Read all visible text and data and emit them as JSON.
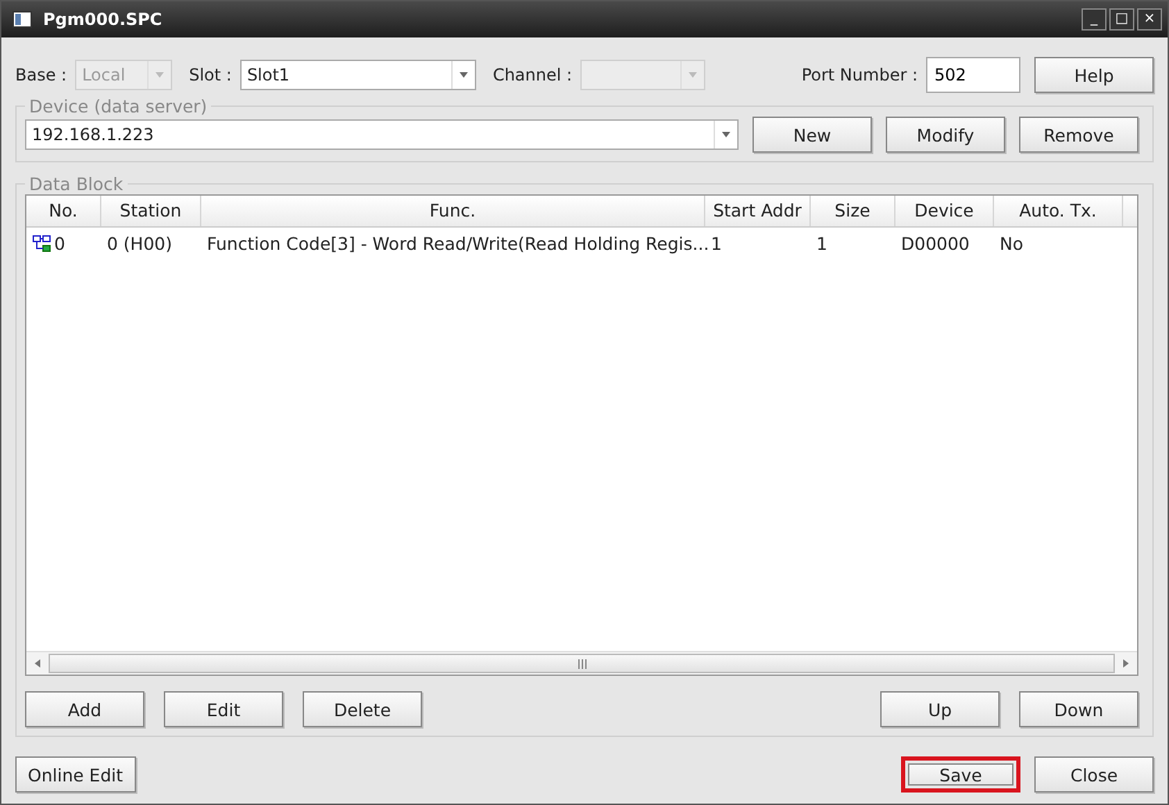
{
  "window": {
    "title": "Pgm000.SPC",
    "controls": [
      "_",
      "□",
      "×"
    ]
  },
  "base": {
    "label": "Base :",
    "value": "Local",
    "disabled": true
  },
  "slot": {
    "label": "Slot :",
    "value": "Slot1",
    "disabled": false
  },
  "channel": {
    "label": "Channel :",
    "disabled": true
  },
  "port": {
    "label": "Port Number :",
    "value": "502"
  },
  "help_button": "Help",
  "device_group": {
    "title": "Device (data server)",
    "value": "192.168.1.223",
    "buttons": [
      "New",
      "Modify",
      "Remove"
    ]
  },
  "data_block": {
    "title": "Data Block",
    "table": {
      "columns": [
        "No.",
        "Station",
        "Func.",
        "Start Addr",
        "Size",
        "Device",
        "Auto. Tx."
      ],
      "rows": [
        [
          "0",
          "0 (H00)",
          "Function Code[3] - Word Read/Write(Read Holding Regis...",
          "1",
          "1",
          "D00000",
          "No"
        ]
      ]
    },
    "left_buttons": [
      "Add",
      "Edit",
      "Delete"
    ],
    "right_buttons": [
      "Up",
      "Down"
    ]
  },
  "footer": {
    "left_button": "Online Edit",
    "buttons": [
      {
        "label": "Save",
        "highlighted": true
      },
      {
        "label": "Close",
        "highlighted": false
      }
    ]
  }
}
